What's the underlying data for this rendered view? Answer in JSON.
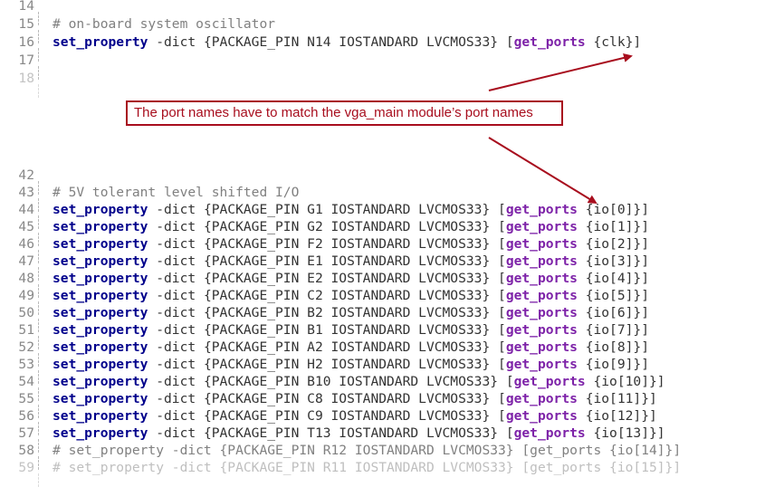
{
  "editor": {
    "top_lines": [
      {
        "num": "14",
        "text": ""
      },
      {
        "num": "15",
        "comment": "# on-board system oscillator"
      },
      {
        "num": "16",
        "cmd": "set_property",
        "args": " -dict {PACKAGE_PIN N14 IOSTANDARD LVCMOS33} [",
        "get_ports": "get_ports",
        "port": " {clk}]"
      },
      {
        "num": "17",
        "text": ""
      },
      {
        "num": "18",
        "text": ""
      }
    ],
    "bottom_lines": [
      {
        "num": "42",
        "text": ""
      },
      {
        "num": "43",
        "comment": "# 5V tolerant level shifted I/O"
      },
      {
        "num": "44",
        "cmd": "set_property",
        "args": " -dict {PACKAGE_PIN G1 IOSTANDARD LVCMOS33} [",
        "get_ports": "get_ports",
        "port": " {io[0]}]"
      },
      {
        "num": "45",
        "cmd": "set_property",
        "args": " -dict {PACKAGE_PIN G2 IOSTANDARD LVCMOS33} [",
        "get_ports": "get_ports",
        "port": " {io[1]}]"
      },
      {
        "num": "46",
        "cmd": "set_property",
        "args": " -dict {PACKAGE_PIN F2 IOSTANDARD LVCMOS33} [",
        "get_ports": "get_ports",
        "port": " {io[2]}]"
      },
      {
        "num": "47",
        "cmd": "set_property",
        "args": " -dict {PACKAGE_PIN E1 IOSTANDARD LVCMOS33} [",
        "get_ports": "get_ports",
        "port": " {io[3]}]"
      },
      {
        "num": "48",
        "cmd": "set_property",
        "args": " -dict {PACKAGE_PIN E2 IOSTANDARD LVCMOS33} [",
        "get_ports": "get_ports",
        "port": " {io[4]}]"
      },
      {
        "num": "49",
        "cmd": "set_property",
        "args": " -dict {PACKAGE_PIN C2 IOSTANDARD LVCMOS33} [",
        "get_ports": "get_ports",
        "port": " {io[5]}]"
      },
      {
        "num": "50",
        "cmd": "set_property",
        "args": " -dict {PACKAGE_PIN B2 IOSTANDARD LVCMOS33} [",
        "get_ports": "get_ports",
        "port": " {io[6]}]"
      },
      {
        "num": "51",
        "cmd": "set_property",
        "args": " -dict {PACKAGE_PIN B1 IOSTANDARD LVCMOS33} [",
        "get_ports": "get_ports",
        "port": " {io[7]}]"
      },
      {
        "num": "52",
        "cmd": "set_property",
        "args": " -dict {PACKAGE_PIN A2 IOSTANDARD LVCMOS33} [",
        "get_ports": "get_ports",
        "port": " {io[8]}]"
      },
      {
        "num": "53",
        "cmd": "set_property",
        "args": " -dict {PACKAGE_PIN H2 IOSTANDARD LVCMOS33} [",
        "get_ports": "get_ports",
        "port": " {io[9]}]"
      },
      {
        "num": "54",
        "cmd": "set_property",
        "args": " -dict {PACKAGE_PIN B10 IOSTANDARD LVCMOS33} [",
        "get_ports": "get_ports",
        "port": " {io[10]}]"
      },
      {
        "num": "55",
        "cmd": "set_property",
        "args": " -dict {PACKAGE_PIN C8 IOSTANDARD LVCMOS33} [",
        "get_ports": "get_ports",
        "port": " {io[11]}]"
      },
      {
        "num": "56",
        "cmd": "set_property",
        "args": " -dict {PACKAGE_PIN C9 IOSTANDARD LVCMOS33} [",
        "get_ports": "get_ports",
        "port": " {io[12]}]"
      },
      {
        "num": "57",
        "cmd": "set_property",
        "args": " -dict {PACKAGE_PIN T13 IOSTANDARD LVCMOS33} [",
        "get_ports": "get_ports",
        "port": " {io[13]}]"
      },
      {
        "num": "58",
        "comment": "# set_property -dict {PACKAGE_PIN R12 IOSTANDARD LVCMOS33} [get_ports {io[14]}]"
      },
      {
        "num": "59",
        "comment": "# set_property -dict {PACKAGE_PIN R11 IOSTANDARD LVCMOS33} [get_ports {io[15]}]"
      }
    ]
  },
  "annotation": {
    "text": "The port names have to match the vga_main module’s port names",
    "color": "#a80e1e"
  },
  "colors": {
    "keyword": "#00008b",
    "get_ports": "#7d22a8",
    "comment": "#808080",
    "line_number": "#888888"
  }
}
